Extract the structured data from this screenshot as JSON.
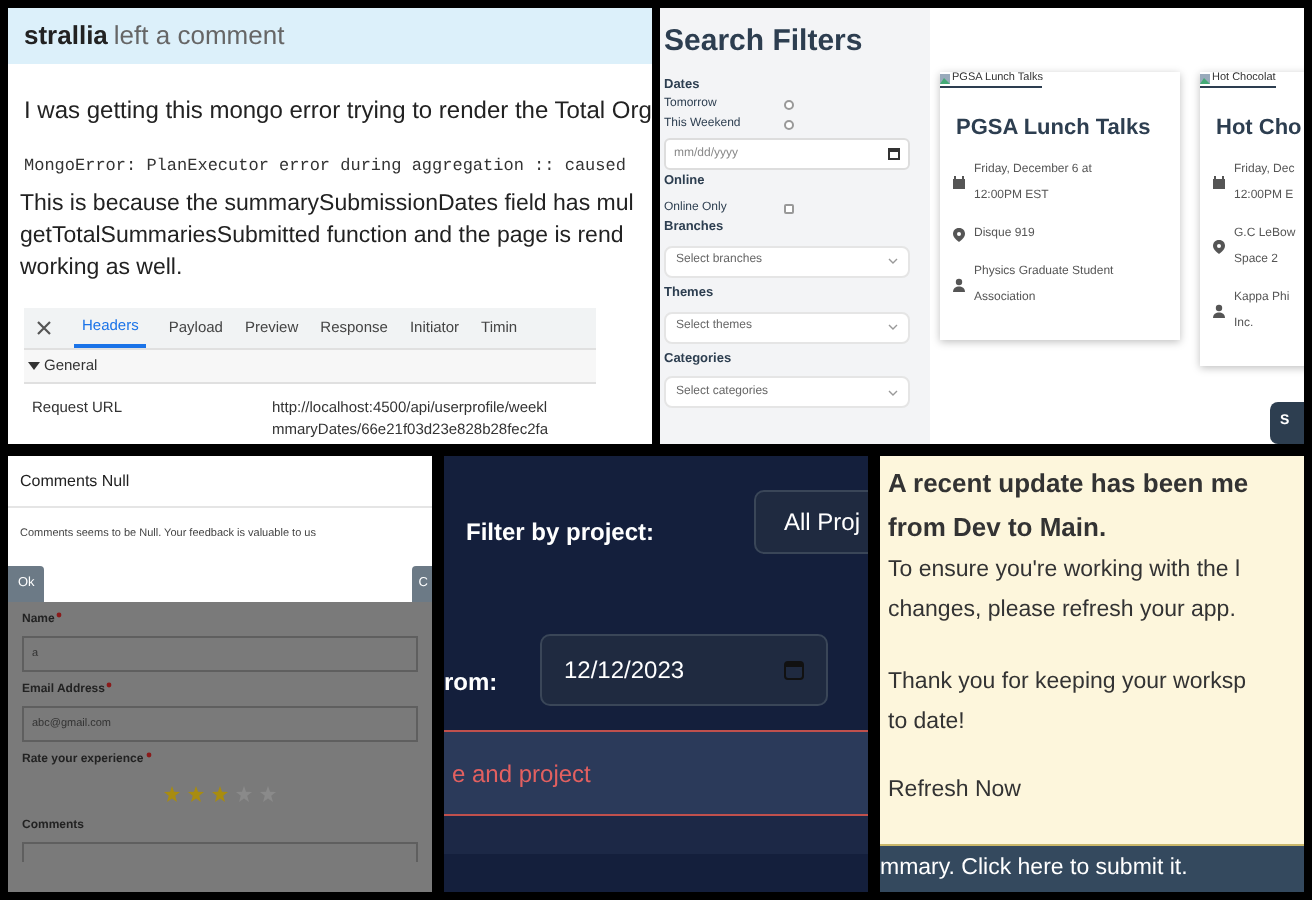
{
  "comment_panel": {
    "author": "strallia",
    "action": "left a comment",
    "paragraph_1": "I was getting this mongo error trying to render the Total Org",
    "code": "MongoError: PlanExecutor error during aggregation :: caused",
    "paragraph_2_lines": [
      "This is because the summarySubmissionDates field has mul",
      "getTotalSummariesSubmitted function and the page is rend",
      "working as well."
    ],
    "devtools": {
      "tabs": [
        {
          "label": "Headers",
          "selected": true
        },
        {
          "label": "Payload",
          "selected": false
        },
        {
          "label": "Preview",
          "selected": false
        },
        {
          "label": "Response",
          "selected": false
        },
        {
          "label": "Initiator",
          "selected": false
        },
        {
          "label": "Timin",
          "selected": false
        }
      ],
      "section": {
        "label": "General",
        "expanded": true
      },
      "row": {
        "label": "Request URL",
        "value_lines": [
          "http://localhost:4500/api/userprofile/weekl",
          "mmaryDates/66e21f03d23e828b28fec2fa"
        ]
      }
    }
  },
  "search_panel": {
    "title": "Search Filters",
    "dates": {
      "label": "Dates",
      "options": [
        {
          "label": "Tomorrow",
          "checked": false
        },
        {
          "label": "This Weekend",
          "checked": false
        }
      ],
      "date_placeholder": "mm/dd/yyyy"
    },
    "online": {
      "label": "Online",
      "option": {
        "label": "Online Only",
        "checked": false
      }
    },
    "selects": [
      {
        "label": "Branches",
        "placeholder": "Select branches"
      },
      {
        "label": "Themes",
        "placeholder": "Select themes"
      },
      {
        "label": "Categories",
        "placeholder": "Select categories"
      }
    ],
    "cards": [
      {
        "image_alt": "PGSA Lunch Talks",
        "title": "PGSA Lunch Talks",
        "date_lines": [
          "Friday, December 6 at",
          "12:00PM EST"
        ],
        "location_lines": [
          "Disque 919"
        ],
        "organizer_lines": [
          "Physics Graduate Student",
          "Association"
        ]
      },
      {
        "image_alt": "Hot Chocolat",
        "title": "Hot Cho",
        "date_lines": [
          "Friday, Dec",
          "12:00PM E"
        ],
        "location_lines": [
          "G.C LeBow",
          "Space 2"
        ],
        "organizer_lines": [
          "Kappa Phi",
          "Inc."
        ]
      }
    ],
    "button": "S"
  },
  "feedback_panel": {
    "dialog": {
      "title": "Comments Null",
      "message": "Comments seems to be Null. Your feedback is valuable to us",
      "buttons": [
        "Ok",
        "C"
      ]
    },
    "fields": [
      {
        "label": "Name",
        "required": true,
        "value": "a"
      },
      {
        "label": "Email Address",
        "required": true,
        "value": "abc@gmail.com"
      }
    ],
    "rating": {
      "label": "Rate your experience",
      "required": true,
      "stars": 3
    },
    "comments_label": "Comments"
  },
  "filter_panel": {
    "project_label": "Filter by project:",
    "project_value": "All Proj",
    "date_label": "rom:",
    "date_value": "12/12/2023",
    "error": "e and project"
  },
  "update_panel": {
    "heading_lines": [
      "A recent update has been me",
      "from Dev to Main."
    ],
    "text_lines": [
      "To ensure you're working with the l",
      "changes, please refresh your app."
    ],
    "thanks_lines": [
      "Thank you for keeping your worksp",
      "to date!"
    ],
    "link": "Refresh Now",
    "banner": "mmary. Click here to submit it."
  }
}
